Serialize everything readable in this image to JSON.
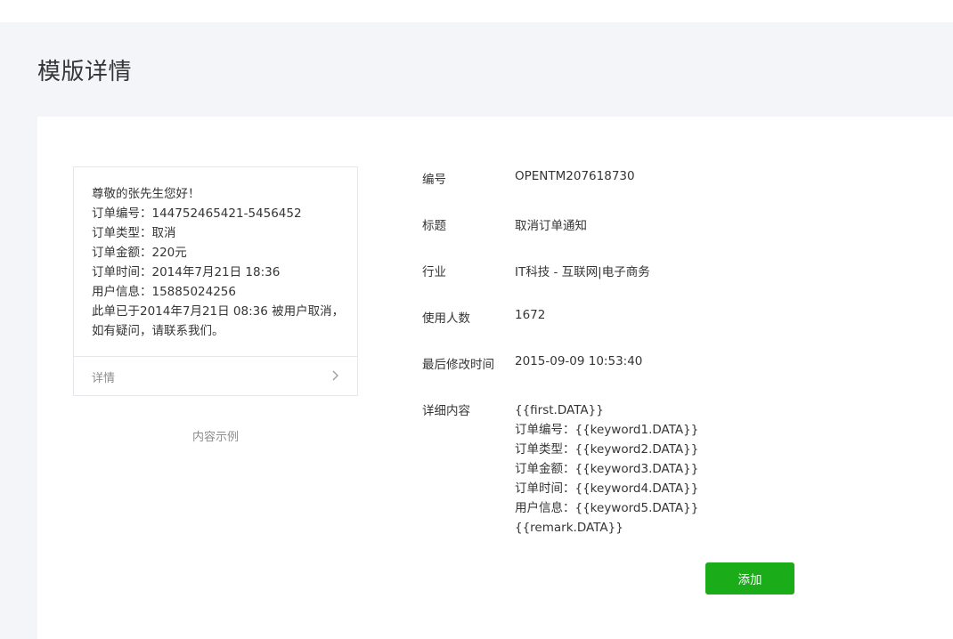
{
  "page": {
    "title": "模版详情"
  },
  "preview": {
    "lines": [
      "尊敬的张先生您好！",
      "订单编号：144752465421-5456452",
      "订单类型：取消",
      "订单金额：220元",
      "订单时间：2014年7月21日 18:36",
      "用户信息：15885024256",
      "此单已于2014年7月21日 08:36 被用户取消，如有疑问，请联系我们。"
    ],
    "detail_label": "详情",
    "caption": "内容示例"
  },
  "info": {
    "id_label": "编号",
    "id_value": "OPENTM207618730",
    "title_label": "标题",
    "title_value": "取消订单通知",
    "industry_label": "行业",
    "industry_value": "IT科技 - 互联网|电子商务",
    "users_label": "使用人数",
    "users_value": "1672",
    "modified_label": "最后修改时间",
    "modified_value": "2015-09-09 10:53:40",
    "content_label": "详细内容",
    "content_lines": [
      "{{first.DATA}}",
      "订单编号：{{keyword1.DATA}}",
      "订单类型：{{keyword2.DATA}}",
      "订单金额：{{keyword3.DATA}}",
      "订单时间：{{keyword4.DATA}}",
      "用户信息：{{keyword5.DATA}}",
      "{{remark.DATA}}"
    ]
  },
  "actions": {
    "add_label": "添加"
  },
  "colors": {
    "accent": "#1aad19",
    "background": "#f4f5f9",
    "border": "#e7e7eb",
    "muted_text": "#8d8d8d"
  },
  "icons": {
    "detail_arrow": "chevron-right-icon"
  }
}
